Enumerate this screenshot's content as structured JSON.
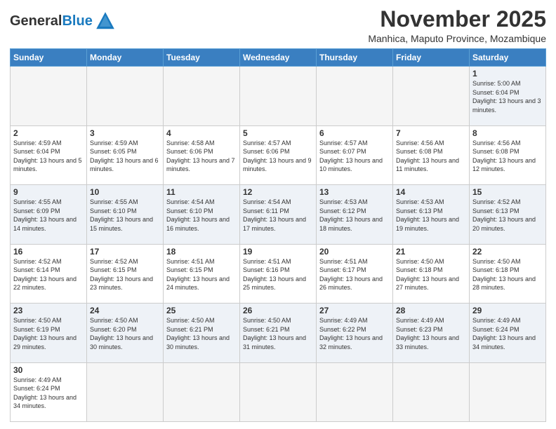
{
  "header": {
    "logo_general": "General",
    "logo_blue": "Blue",
    "month_title": "November 2025",
    "location": "Manhica, Maputo Province, Mozambique"
  },
  "days_of_week": [
    "Sunday",
    "Monday",
    "Tuesday",
    "Wednesday",
    "Thursday",
    "Friday",
    "Saturday"
  ],
  "weeks": [
    [
      {
        "day": "",
        "info": ""
      },
      {
        "day": "",
        "info": ""
      },
      {
        "day": "",
        "info": ""
      },
      {
        "day": "",
        "info": ""
      },
      {
        "day": "",
        "info": ""
      },
      {
        "day": "",
        "info": ""
      },
      {
        "day": "1",
        "info": "Sunrise: 5:00 AM\nSunset: 6:04 PM\nDaylight: 13 hours and 3 minutes."
      }
    ],
    [
      {
        "day": "2",
        "info": "Sunrise: 4:59 AM\nSunset: 6:04 PM\nDaylight: 13 hours and 5 minutes."
      },
      {
        "day": "3",
        "info": "Sunrise: 4:59 AM\nSunset: 6:05 PM\nDaylight: 13 hours and 6 minutes."
      },
      {
        "day": "4",
        "info": "Sunrise: 4:58 AM\nSunset: 6:06 PM\nDaylight: 13 hours and 7 minutes."
      },
      {
        "day": "5",
        "info": "Sunrise: 4:57 AM\nSunset: 6:06 PM\nDaylight: 13 hours and 9 minutes."
      },
      {
        "day": "6",
        "info": "Sunrise: 4:57 AM\nSunset: 6:07 PM\nDaylight: 13 hours and 10 minutes."
      },
      {
        "day": "7",
        "info": "Sunrise: 4:56 AM\nSunset: 6:08 PM\nDaylight: 13 hours and 11 minutes."
      },
      {
        "day": "8",
        "info": "Sunrise: 4:56 AM\nSunset: 6:08 PM\nDaylight: 13 hours and 12 minutes."
      }
    ],
    [
      {
        "day": "9",
        "info": "Sunrise: 4:55 AM\nSunset: 6:09 PM\nDaylight: 13 hours and 14 minutes."
      },
      {
        "day": "10",
        "info": "Sunrise: 4:55 AM\nSunset: 6:10 PM\nDaylight: 13 hours and 15 minutes."
      },
      {
        "day": "11",
        "info": "Sunrise: 4:54 AM\nSunset: 6:10 PM\nDaylight: 13 hours and 16 minutes."
      },
      {
        "day": "12",
        "info": "Sunrise: 4:54 AM\nSunset: 6:11 PM\nDaylight: 13 hours and 17 minutes."
      },
      {
        "day": "13",
        "info": "Sunrise: 4:53 AM\nSunset: 6:12 PM\nDaylight: 13 hours and 18 minutes."
      },
      {
        "day": "14",
        "info": "Sunrise: 4:53 AM\nSunset: 6:13 PM\nDaylight: 13 hours and 19 minutes."
      },
      {
        "day": "15",
        "info": "Sunrise: 4:52 AM\nSunset: 6:13 PM\nDaylight: 13 hours and 20 minutes."
      }
    ],
    [
      {
        "day": "16",
        "info": "Sunrise: 4:52 AM\nSunset: 6:14 PM\nDaylight: 13 hours and 22 minutes."
      },
      {
        "day": "17",
        "info": "Sunrise: 4:52 AM\nSunset: 6:15 PM\nDaylight: 13 hours and 23 minutes."
      },
      {
        "day": "18",
        "info": "Sunrise: 4:51 AM\nSunset: 6:15 PM\nDaylight: 13 hours and 24 minutes."
      },
      {
        "day": "19",
        "info": "Sunrise: 4:51 AM\nSunset: 6:16 PM\nDaylight: 13 hours and 25 minutes."
      },
      {
        "day": "20",
        "info": "Sunrise: 4:51 AM\nSunset: 6:17 PM\nDaylight: 13 hours and 26 minutes."
      },
      {
        "day": "21",
        "info": "Sunrise: 4:50 AM\nSunset: 6:18 PM\nDaylight: 13 hours and 27 minutes."
      },
      {
        "day": "22",
        "info": "Sunrise: 4:50 AM\nSunset: 6:18 PM\nDaylight: 13 hours and 28 minutes."
      }
    ],
    [
      {
        "day": "23",
        "info": "Sunrise: 4:50 AM\nSunset: 6:19 PM\nDaylight: 13 hours and 29 minutes."
      },
      {
        "day": "24",
        "info": "Sunrise: 4:50 AM\nSunset: 6:20 PM\nDaylight: 13 hours and 30 minutes."
      },
      {
        "day": "25",
        "info": "Sunrise: 4:50 AM\nSunset: 6:21 PM\nDaylight: 13 hours and 30 minutes."
      },
      {
        "day": "26",
        "info": "Sunrise: 4:50 AM\nSunset: 6:21 PM\nDaylight: 13 hours and 31 minutes."
      },
      {
        "day": "27",
        "info": "Sunrise: 4:49 AM\nSunset: 6:22 PM\nDaylight: 13 hours and 32 minutes."
      },
      {
        "day": "28",
        "info": "Sunrise: 4:49 AM\nSunset: 6:23 PM\nDaylight: 13 hours and 33 minutes."
      },
      {
        "day": "29",
        "info": "Sunrise: 4:49 AM\nSunset: 6:24 PM\nDaylight: 13 hours and 34 minutes."
      }
    ],
    [
      {
        "day": "30",
        "info": "Sunrise: 4:49 AM\nSunset: 6:24 PM\nDaylight: 13 hours and 34 minutes."
      },
      {
        "day": "",
        "info": ""
      },
      {
        "day": "",
        "info": ""
      },
      {
        "day": "",
        "info": ""
      },
      {
        "day": "",
        "info": ""
      },
      {
        "day": "",
        "info": ""
      },
      {
        "day": "",
        "info": ""
      }
    ]
  ]
}
